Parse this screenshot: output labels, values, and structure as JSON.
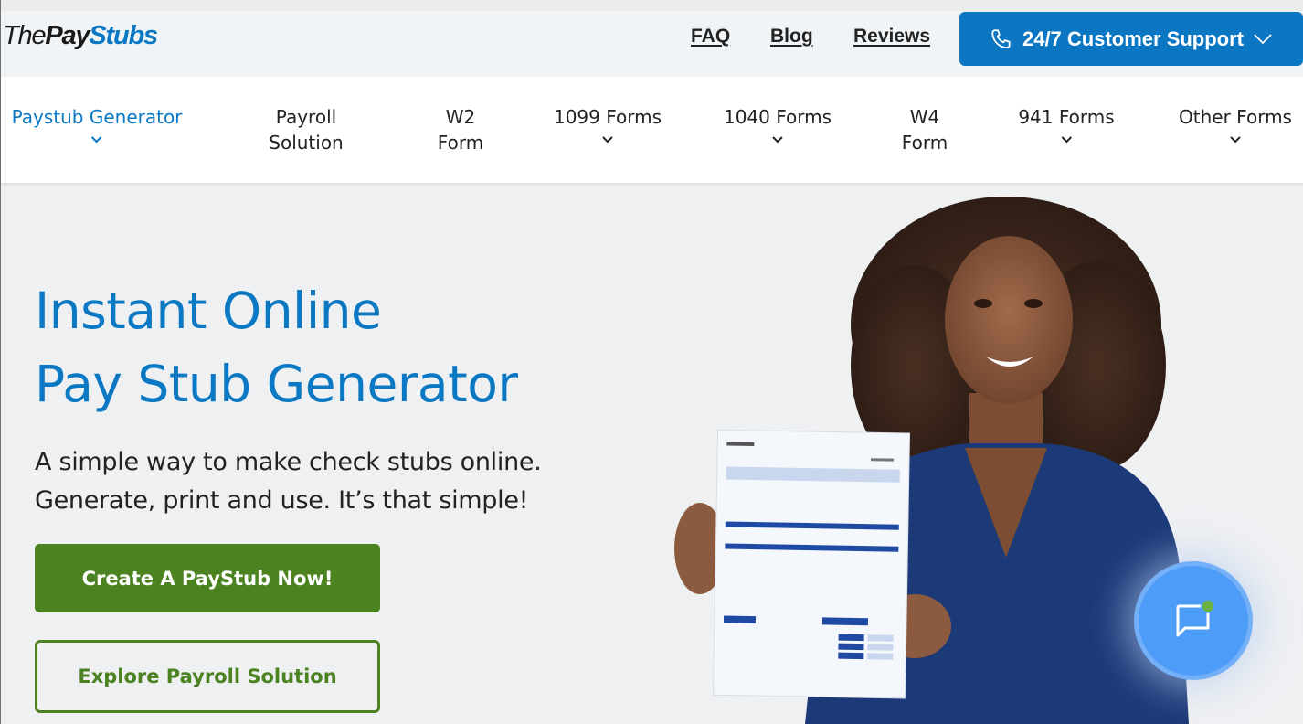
{
  "brand": {
    "logo_the": "The",
    "logo_pay": "Pay",
    "logo_stubs": "Stubs",
    "primary_color": "#0a78c3",
    "green_color": "#4b8321"
  },
  "top_links": [
    {
      "label": "FAQ"
    },
    {
      "label": "Blog"
    },
    {
      "label": "Reviews"
    }
  ],
  "support_button": {
    "label": "24/7 Customer Support",
    "icon": "phone-icon",
    "dropdown_icon": "chevron-down-icon"
  },
  "nav": {
    "items": [
      {
        "line1": "Paystub Generator",
        "line2": "",
        "has_dropdown": true,
        "active": true
      },
      {
        "line1": "Payroll",
        "line2": "Solution",
        "has_dropdown": false,
        "active": false
      },
      {
        "line1": "W2",
        "line2": "Form",
        "has_dropdown": false,
        "active": false
      },
      {
        "line1": "1099 Forms",
        "line2": "",
        "has_dropdown": true,
        "active": false
      },
      {
        "line1": "1040 Forms",
        "line2": "",
        "has_dropdown": true,
        "active": false
      },
      {
        "line1": "W4",
        "line2": "Form",
        "has_dropdown": false,
        "active": false
      },
      {
        "line1": "941 Forms",
        "line2": "",
        "has_dropdown": true,
        "active": false
      },
      {
        "line1": "Other Forms",
        "line2": "",
        "has_dropdown": true,
        "active": false
      }
    ]
  },
  "hero": {
    "title_line1": "Instant Online",
    "title_line2": "Pay Stub Generator",
    "subtitle_line1": "A simple way to make check stubs online.",
    "subtitle_line2": "Generate, print and use. It’s that simple!",
    "primary_cta": "Create A PayStub Now!",
    "secondary_cta": "Explore Payroll Solution",
    "image_alt": "Woman holding a sample pay stub"
  },
  "chat_widget": {
    "icon": "chat-bubble-icon",
    "status": "online"
  }
}
